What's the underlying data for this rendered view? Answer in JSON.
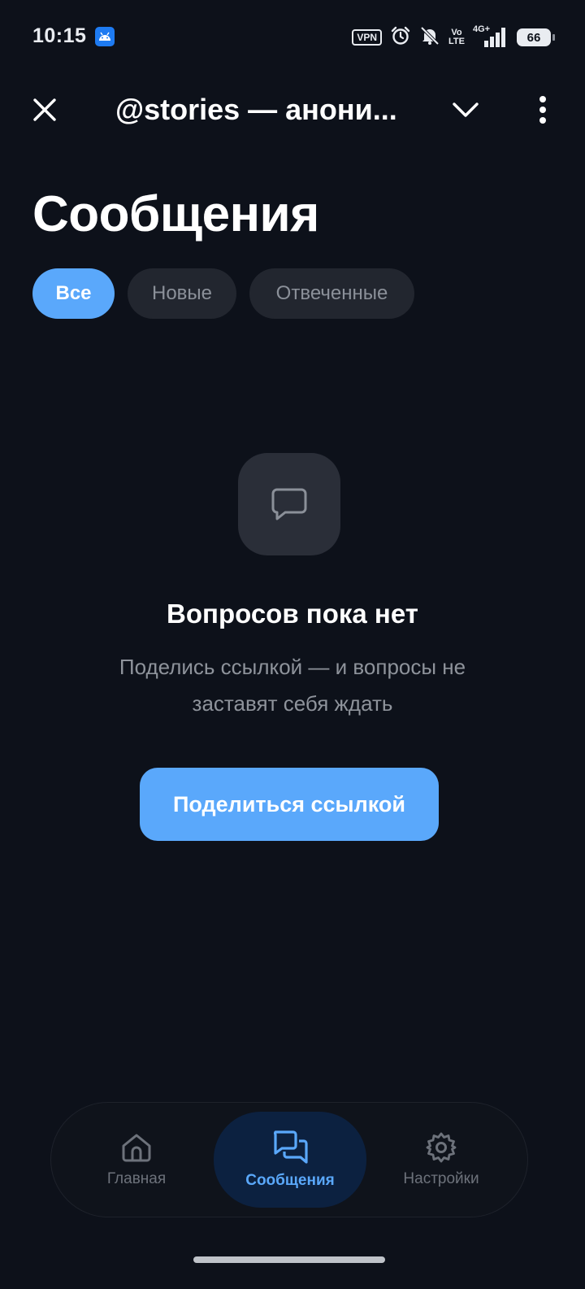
{
  "status_bar": {
    "time": "10:15",
    "vpn": "VPN",
    "volte_top": "Vo",
    "volte_bottom": "LTE",
    "network": "4G+",
    "battery": "66"
  },
  "topbar": {
    "title": "@stories — анони..."
  },
  "page": {
    "title": "Сообщения"
  },
  "filters": [
    {
      "label": "Все",
      "active": true
    },
    {
      "label": "Новые",
      "active": false
    },
    {
      "label": "Отвеченные",
      "active": false
    }
  ],
  "empty_state": {
    "title": "Вопросов пока нет",
    "subtitle": "Поделись ссылкой — и вопросы не заставят себя ждать",
    "button": "Поделиться ссылкой"
  },
  "bottom_nav": {
    "home": "Главная",
    "messages": "Сообщения",
    "settings": "Настройки"
  },
  "colors": {
    "background": "#0d111a",
    "accent": "#5aa8fb",
    "chip_inactive": "#22262f",
    "muted_text": "#8e939b"
  }
}
